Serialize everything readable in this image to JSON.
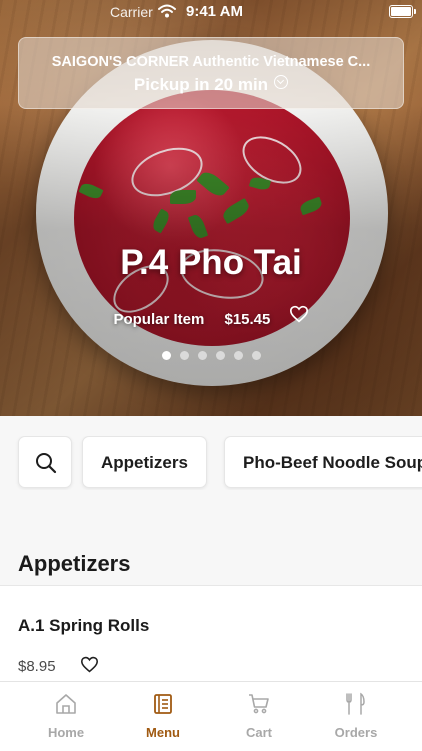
{
  "status_bar": {
    "carrier": "Carrier",
    "time": "9:41 AM"
  },
  "header": {
    "store_name": "SAIGON'S CORNER Authentic Vietnamese C...",
    "pickup": "Pickup in 20 min"
  },
  "hero": {
    "dish_name": "P.4 Pho Tai",
    "badge": "Popular Item",
    "price": "$15.45",
    "slide_count": 6,
    "active_slide": 1
  },
  "categories": [
    "Appetizers",
    "Pho-Beef Noodle Soup"
  ],
  "section": {
    "title": "Appetizers"
  },
  "items": [
    {
      "name": "A.1 Spring Rolls",
      "price": "$8.95"
    }
  ],
  "tabs": [
    {
      "label": "Home",
      "icon": "home-icon"
    },
    {
      "label": "Menu",
      "icon": "menu-icon",
      "active": true
    },
    {
      "label": "Cart",
      "icon": "cart-icon"
    },
    {
      "label": "Orders",
      "icon": "orders-icon"
    }
  ],
  "colors": {
    "accent": "#a05a12",
    "inactive_tab": "#a8a8a8"
  }
}
